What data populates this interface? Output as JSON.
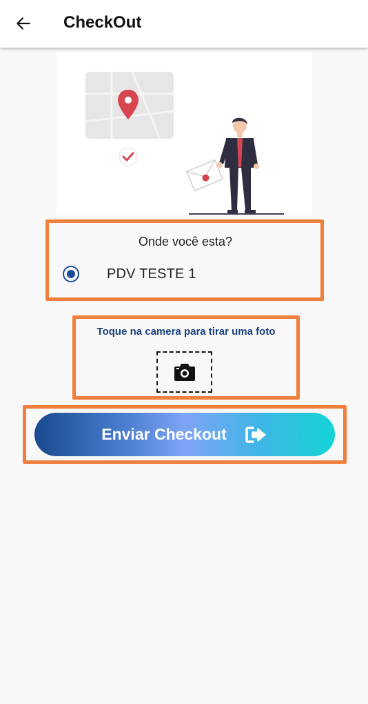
{
  "header": {
    "title": "CheckOut",
    "back_icon": "arrow-left-icon"
  },
  "illustration": {
    "name": "location-checkin-illustration",
    "colors": {
      "pin": "#d64550",
      "map": "#e6e6e6",
      "suit": "#2f2e41"
    }
  },
  "location": {
    "question": "Onde você esta?",
    "options": [
      {
        "label": "PDV TESTE 1",
        "selected": true
      }
    ]
  },
  "camera": {
    "hint": "Toque na camera para tirar uma foto",
    "icon": "camera-icon"
  },
  "submit": {
    "label": "Enviar Checkout",
    "icon": "sign-out-icon"
  },
  "colors": {
    "highlight": "#f07f3c",
    "primary": "#1c4c96",
    "gradient_start": "#1a4a8f",
    "gradient_end": "#14d4d6"
  }
}
